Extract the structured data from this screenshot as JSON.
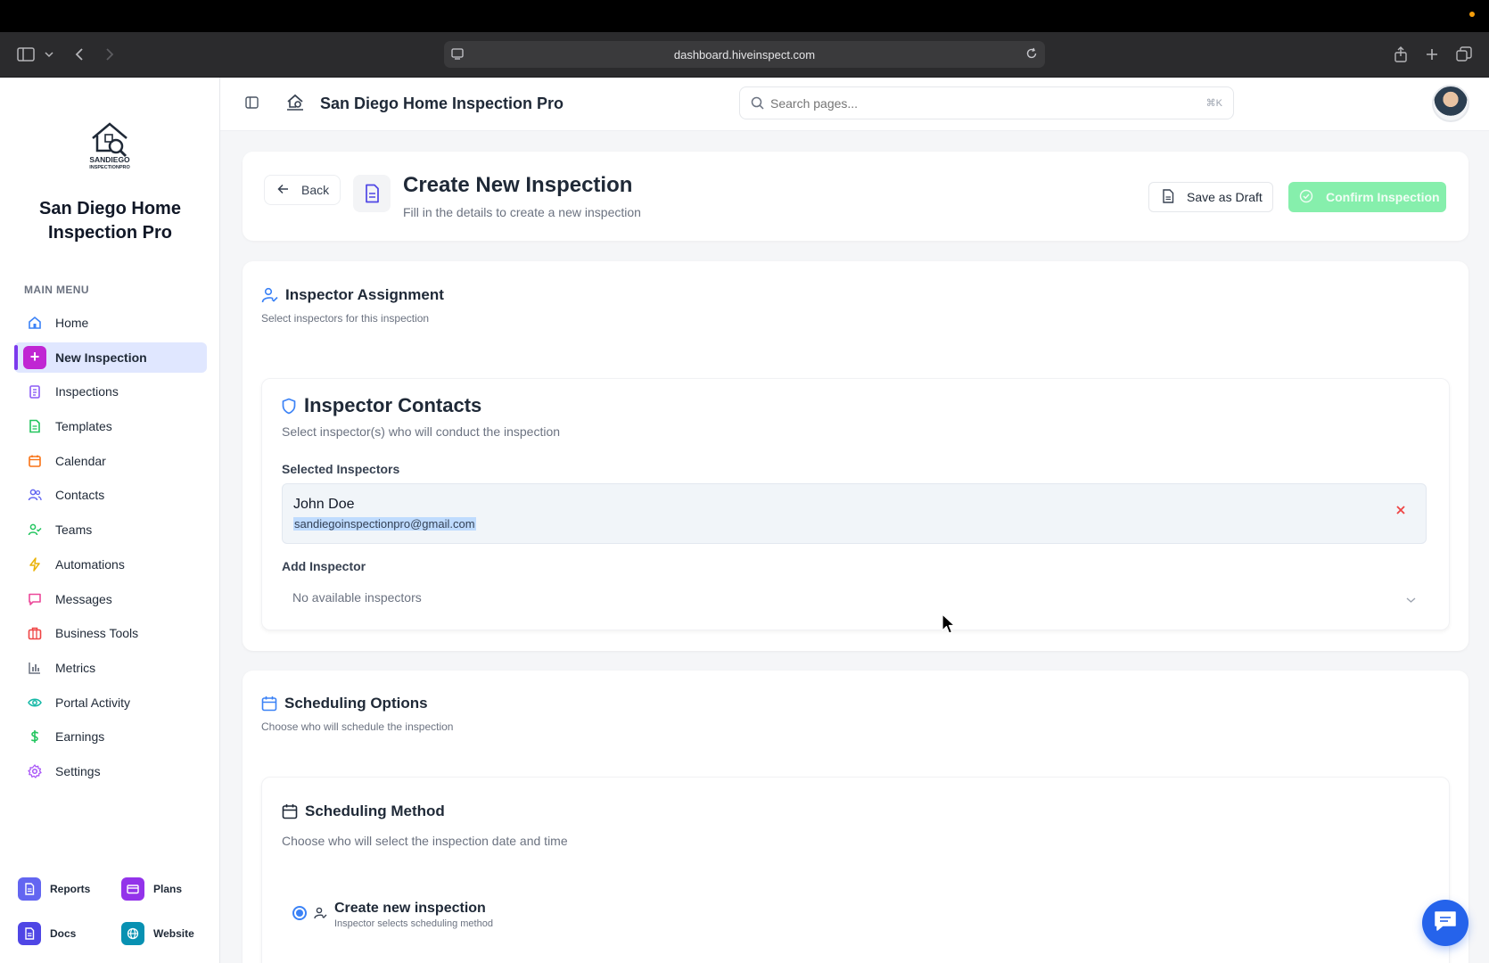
{
  "browser": {
    "url": "dashboard.hiveinspect.com"
  },
  "sidebar": {
    "logo_text": "SANDIEGO INSPECTIONPRO",
    "brand_line1": "San Diego Home",
    "brand_line2": "Inspection Pro",
    "menu_title": "MAIN MENU",
    "items": [
      {
        "label": "Home",
        "icon": "home-icon",
        "color": "#3b82f6"
      },
      {
        "label": "New Inspection",
        "icon": "plus-icon",
        "color": "#c026d3",
        "active": true
      },
      {
        "label": "Inspections",
        "icon": "clipboard-icon",
        "color": "#8b5cf6"
      },
      {
        "label": "Templates",
        "icon": "file-icon",
        "color": "#22c55e"
      },
      {
        "label": "Calendar",
        "icon": "calendar-icon",
        "color": "#f97316"
      },
      {
        "label": "Contacts",
        "icon": "users-icon",
        "color": "#6366f1"
      },
      {
        "label": "Teams",
        "icon": "team-icon",
        "color": "#22c55e"
      },
      {
        "label": "Automations",
        "icon": "zap-icon",
        "color": "#eab308"
      },
      {
        "label": "Messages",
        "icon": "message-icon",
        "color": "#ec4899"
      },
      {
        "label": "Business Tools",
        "icon": "briefcase-icon",
        "color": "#ef4444"
      },
      {
        "label": "Metrics",
        "icon": "bar-chart-icon",
        "color": "#6b7280"
      },
      {
        "label": "Portal Activity",
        "icon": "eye-icon",
        "color": "#14b8a6"
      },
      {
        "label": "Earnings",
        "icon": "dollar-icon",
        "color": "#22c55e"
      },
      {
        "label": "Settings",
        "icon": "gear-icon",
        "color": "#a855f7"
      }
    ],
    "bottom_links": [
      {
        "label": "Reports",
        "icon": "report-icon",
        "color": "#6366f1"
      },
      {
        "label": "Plans",
        "icon": "card-icon",
        "color": "#9333ea"
      },
      {
        "label": "Docs",
        "icon": "doc-icon",
        "color": "#4f46e5"
      },
      {
        "label": "Website",
        "icon": "globe-icon",
        "color": "#0891b2"
      }
    ]
  },
  "header": {
    "title": "San Diego Home Inspection Pro",
    "search_placeholder": "Search pages...",
    "search_shortcut": "⌘K"
  },
  "page": {
    "back_label": "Back",
    "title": "Create New Inspection",
    "subtitle": "Fill in the details to create a new inspection",
    "save_draft_label": "Save as Draft",
    "confirm_label": "Confirm Inspection",
    "confirm_color": "#86efac"
  },
  "inspector_assignment": {
    "title": "Inspector Assignment",
    "subtitle": "Select inspectors for this inspection",
    "contacts": {
      "title": "Inspector Contacts",
      "subtitle": "Select inspector(s) who will conduct the inspection",
      "selected_label": "Selected Inspectors",
      "selected": [
        {
          "name": "John Doe",
          "email": "sandiegoinspectionpro@gmail.com"
        }
      ],
      "add_label": "Add Inspector",
      "add_placeholder": "No available inspectors"
    }
  },
  "scheduling": {
    "title": "Scheduling Options",
    "subtitle": "Choose who will schedule the inspection",
    "method": {
      "title": "Scheduling Method",
      "subtitle": "Choose who will select the inspection date and time",
      "options": [
        {
          "label": "Create new inspection",
          "description": "Inspector selects scheduling method",
          "selected": true
        }
      ]
    }
  }
}
